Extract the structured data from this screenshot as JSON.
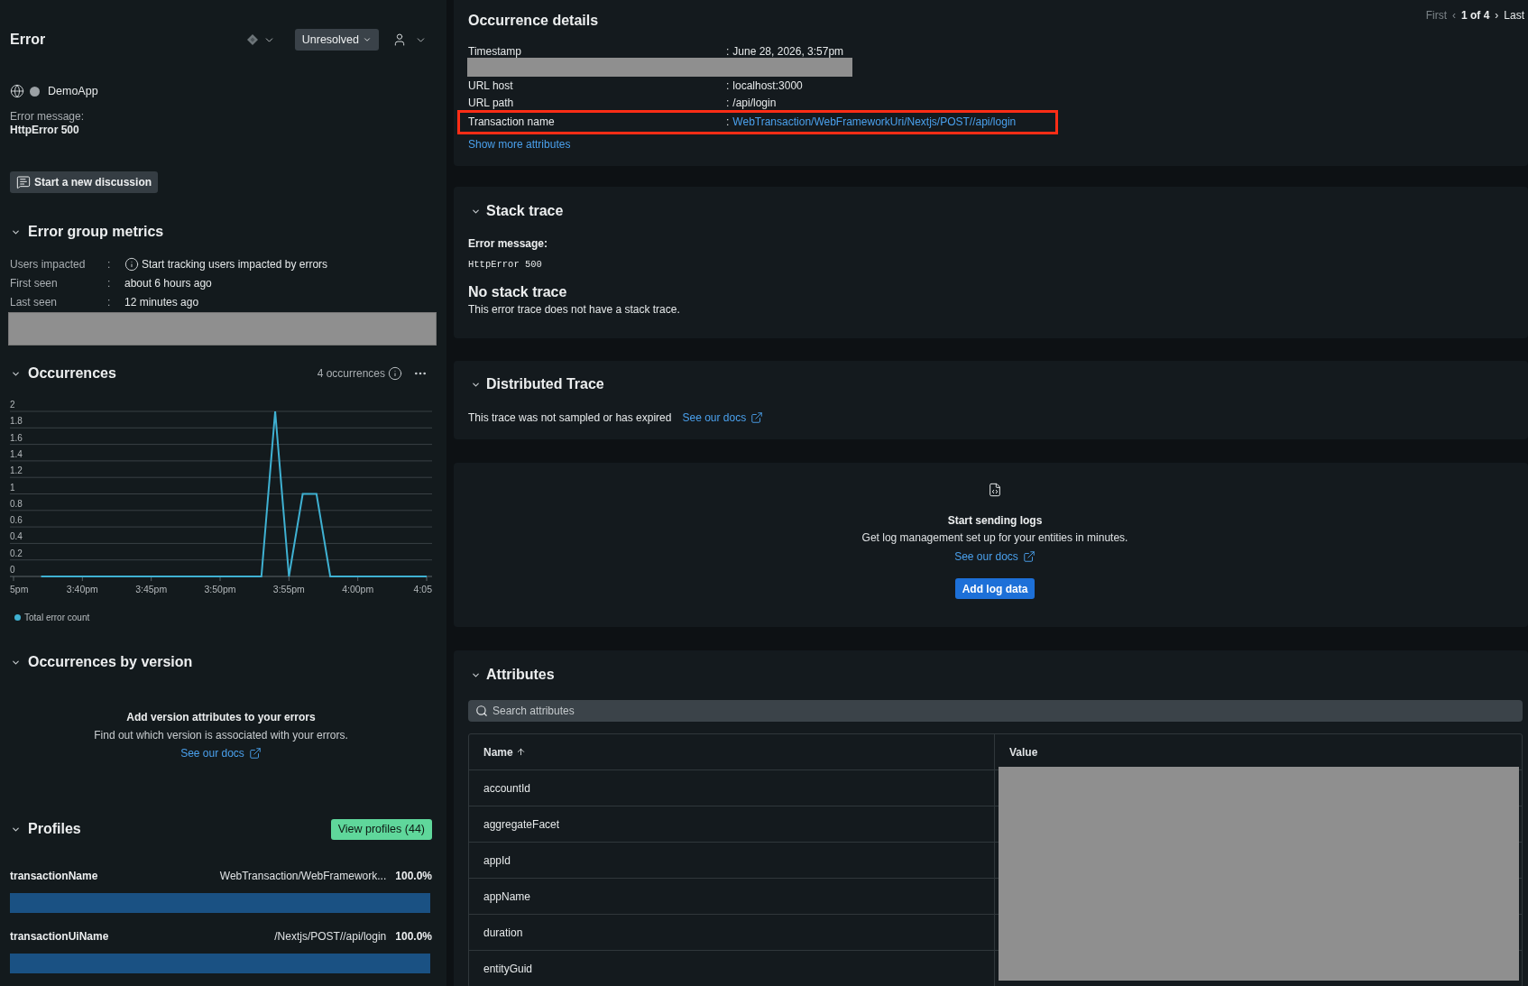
{
  "sidebar": {
    "title": "Error",
    "status_dropdown": {
      "label": "Unresolved"
    },
    "entity": {
      "name": "DemoApp"
    },
    "error_message": {
      "label": "Error message:",
      "value": "HttpError 500"
    },
    "discussion_button": {
      "label": "Start a new discussion"
    },
    "metrics": {
      "title": "Error group metrics",
      "expanded": true,
      "rows": [
        {
          "kind": "hint",
          "label": "Users impacted",
          "separator": ":",
          "value": "Start tracking users impacted by errors"
        },
        {
          "kind": "text",
          "label": "First seen",
          "separator": ":",
          "value": "about 6 hours ago"
        },
        {
          "kind": "text",
          "label": "Last seen",
          "separator": ":",
          "value": "12 minutes ago"
        },
        {
          "kind": "redacted"
        }
      ]
    },
    "occurrences": {
      "title": "Occurrences",
      "expanded": true,
      "count": "4 occurrences",
      "chart_data": {
        "type": "line",
        "categories": [
          "5pm",
          null,
          null,
          null,
          null,
          "3:40pm",
          null,
          null,
          null,
          null,
          "3:45pm",
          null,
          null,
          null,
          null,
          "3:50pm",
          null,
          null,
          null,
          null,
          "3:55pm",
          null,
          null,
          null,
          null,
          "4:00pm",
          null,
          null,
          null,
          null,
          "4:05"
        ],
        "series": [
          {
            "name": "Total error count",
            "color": "#3fb1d2",
            "values": [
              null,
              null,
              0,
              0,
              0,
              0,
              0,
              0,
              0,
              0,
              0,
              0,
              0,
              0,
              0,
              0,
              0,
              0,
              0,
              2,
              0,
              1,
              1,
              0,
              0,
              0,
              0,
              0,
              0,
              0,
              0
            ]
          }
        ],
        "ylim": [
          0,
          2
        ],
        "yticks": [
          0,
          0.2,
          0.4,
          0.6,
          0.8,
          1,
          1.2,
          1.4,
          1.6,
          1.8,
          2
        ],
        "grid": true
      }
    },
    "occurrences_by_version": {
      "title": "Occurrences by version",
      "expanded": true,
      "empty_state": {
        "title": "Add version attributes to your errors",
        "text": "Find out which version is associated with your errors.",
        "link": "See our docs"
      }
    },
    "profiles": {
      "title": "Profiles",
      "expanded": true,
      "button": "View profiles (44)",
      "rows": [
        {
          "name": "transactionName",
          "value": "WebTransaction/WebFramework...",
          "percent": "100.0%",
          "level": 1
        },
        {
          "name": "transactionUiName",
          "value": "/Nextjs/POST//api/login",
          "percent": "100.0%",
          "level": 1
        }
      ]
    }
  },
  "occurrence_details": {
    "title": "Occurrence details",
    "pager": {
      "first": {
        "label": "First",
        "disabled": true
      },
      "previous": {
        "label": "‹",
        "disabled": true
      },
      "position": "1 of 4",
      "next": {
        "label": "›",
        "disabled": false
      },
      "last": {
        "label": "Last",
        "disabled": false
      }
    },
    "fields": [
      {
        "kind": "text",
        "label": "Timestamp",
        "separator": ":",
        "value": "June 28, 2026, 3:57pm",
        "highlighted": false
      },
      {
        "kind": "redacted"
      },
      {
        "kind": "text",
        "label": "URL host",
        "separator": ":",
        "value": "localhost:3000",
        "highlighted": false
      },
      {
        "kind": "text",
        "label": "URL path",
        "separator": ":",
        "value": "/api/login",
        "highlighted": false
      },
      {
        "kind": "link",
        "label": "Transaction name",
        "separator": ":",
        "value": "WebTransaction/WebFrameworkUri/Nextjs/POST//api/login",
        "highlighted": true
      }
    ],
    "more_link": "Show more attributes"
  },
  "stack_trace": {
    "title": "Stack trace",
    "expanded": true,
    "message_label": "Error message:",
    "message": "HttpError 500",
    "empty_title": "No stack trace",
    "empty_text": "This error trace does not have a stack trace."
  },
  "distributed_trace": {
    "title": "Distributed Trace",
    "expanded": true,
    "text": "This trace was not sampled or has expired",
    "link": "See our docs"
  },
  "logs": {
    "title": "Start sending logs",
    "text": "Get log management set up for your entities in minutes.",
    "link": "See our docs",
    "button": "Add log data"
  },
  "attributes": {
    "title": "Attributes",
    "expanded": true,
    "search": {
      "placeholder": "Search attributes"
    },
    "columns": [
      {
        "label": "Name",
        "sorted": true
      },
      {
        "label": "Value",
        "sorted": false
      }
    ],
    "values_redacted": true,
    "rows": [
      {
        "name": "accountId"
      },
      {
        "name": "aggregateFacet"
      },
      {
        "name": "appId"
      },
      {
        "name": "appName"
      },
      {
        "name": "duration"
      },
      {
        "name": "entityGuid"
      }
    ]
  }
}
